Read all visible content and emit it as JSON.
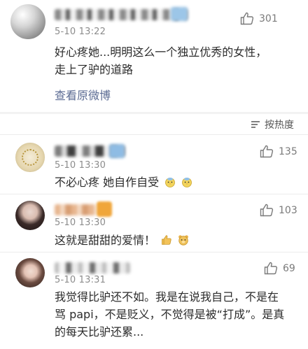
{
  "post": {
    "time": "5-10 13:22",
    "likes": "301",
    "text_line1": "好心疼她...明明这么一个独立优秀的女性，",
    "text_line2": "走上了驴的道路",
    "view_original": "查看原微博"
  },
  "sort_label": "按热度",
  "comments": [
    {
      "time": "5-10 13:30",
      "likes": "135",
      "text": "不必心疼 她自作自受"
    },
    {
      "time": "5-10 13:30",
      "likes": "103",
      "text": "这就是甜甜的爱情！"
    },
    {
      "time": "5-10 13:31",
      "likes": "69",
      "text_line1": "我觉得比驴还不如。我是在说我自己，不是在",
      "text_line2": "骂 papi，不是贬义，不觉得是被“打成”。是真",
      "text_line3": "的每天比驴还累..."
    }
  ],
  "colors": {
    "link": "#5b6b93",
    "meta": "#8c8c8c",
    "text": "#2b2b2b",
    "page_bg": "#f2f2f2"
  },
  "icons": [
    "thumbs-up-icon",
    "sort-icon",
    "chick-emoji-icon",
    "thumbs-up-emoji-icon",
    "bear-face-emoji-icon"
  ]
}
